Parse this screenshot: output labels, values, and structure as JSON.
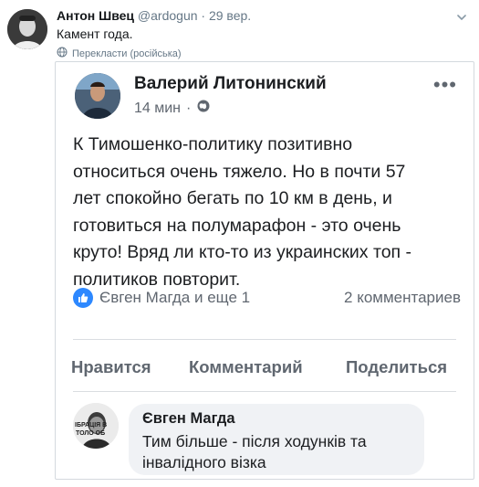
{
  "tweet": {
    "author_name": "Антон Швец",
    "handle": "@ardogun",
    "separator": " · ",
    "date": "29 вер.",
    "text": "Камент года.",
    "translate_label": "Перекласти (російська)"
  },
  "fb_post": {
    "author": "Валерий Литонинский",
    "time": "14 мин",
    "separator": "·",
    "more": "•••",
    "body_lines": [
      "К Тимошенко-политику позитивно",
      "относиться очень тяжело. Но в почти 57",
      "лет спокойно бегать по 10 км в день, и",
      "готовиться на полумарафон - это очень",
      "круто! Вряд ли кто-то из украинских топ -",
      "политиков повторит."
    ],
    "reactions_names": "Євген Магда и еще 1",
    "comments_count": "2 комментариев",
    "actions": {
      "like": "Нравится",
      "comment": "Комментарий",
      "share": "Поделиться"
    }
  },
  "comment": {
    "author": "Євген Магда",
    "text_lines": [
      "Тим більше - після ходунків та",
      "інвалідного візка"
    ],
    "avatar_caption": [
      "ІБРАЦІЯ В",
      "ТОЛО ОБ"
    ]
  },
  "colors": {
    "twitter_text": "#14171a",
    "twitter_gray": "#657786",
    "fb_text": "#1c1e21",
    "fb_gray": "#606770",
    "like_blue": "#2d88ff",
    "bubble_bg": "#f0f2f5"
  },
  "icons": {
    "tweet_menu": "chevron-down-icon",
    "translate": "globe-icon",
    "audience": "globe-icon",
    "like_reaction": "thumbs-up-icon"
  }
}
